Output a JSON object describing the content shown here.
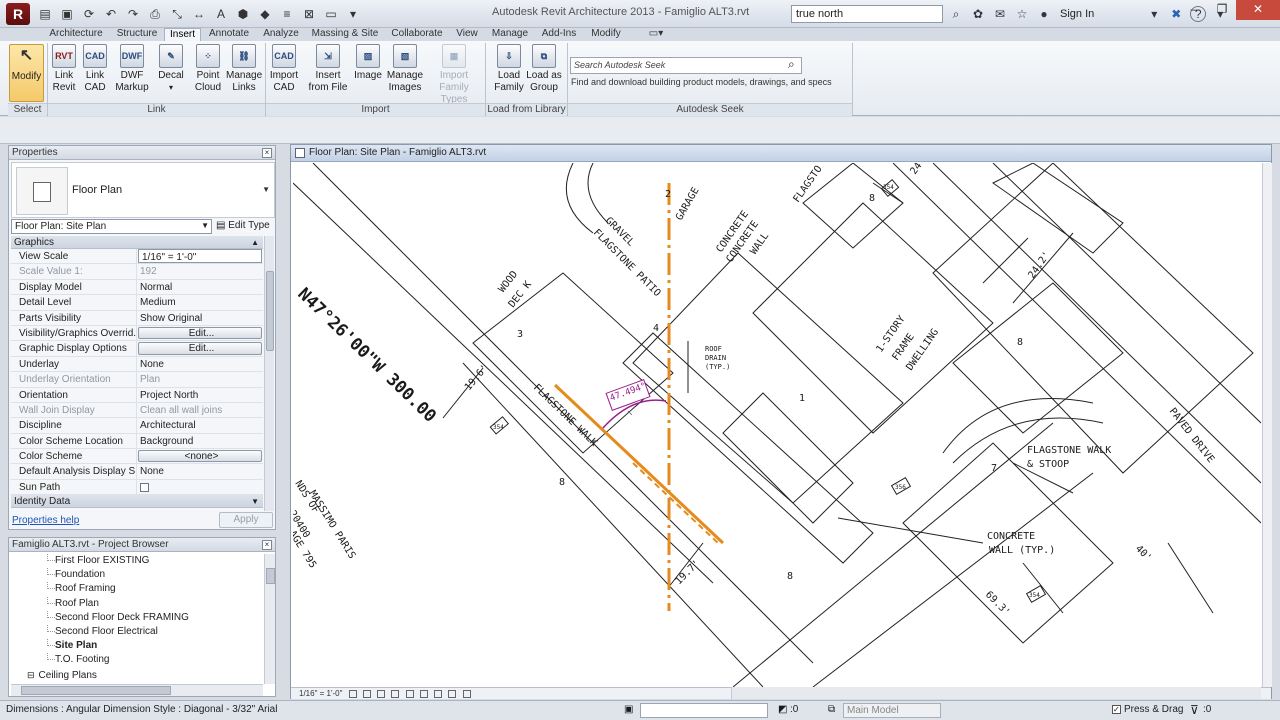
{
  "titlebar": {
    "app_button": "R",
    "title": "Autodesk Revit Architecture 2013 -    Famiglio ALT3.rvt",
    "search_value": "true north",
    "signin": "Sign In",
    "help": "?"
  },
  "ribbon_tabs": [
    "Architecture",
    "Structure",
    "Insert",
    "Annotate",
    "Analyze",
    "Massing & Site",
    "Collaborate",
    "View",
    "Manage",
    "Add-Ins",
    "Modify"
  ],
  "ribbon": {
    "buttons": {
      "modify": "Modify",
      "link_revit": "Link\nRevit",
      "link_cad": "Link\nCAD",
      "dwf_markup": "DWF\nMarkup",
      "decal": "Decal",
      "point_cloud": "Point\nCloud",
      "manage_links": "Manage\nLinks",
      "import_cad": "Import\nCAD",
      "insert_from_file": "Insert\nfrom File",
      "image": "Image",
      "manage_images": "Manage\nImages",
      "import_family_types": "Import\nFamily Types",
      "load_family": "Load\nFamily",
      "load_as_group": "Load as\nGroup"
    },
    "icon_text": {
      "rvt": "RVT",
      "cad": "CAD",
      "dwf": "DWF"
    },
    "panels": {
      "select": "Select",
      "link": "Link",
      "import": "Import",
      "load_from_library": "Load from Library",
      "autodesk_seek": "Autodesk Seek"
    },
    "seek_placeholder": "Search Autodesk Seek",
    "seek_description": "Find and download building product models, drawings, and specs"
  },
  "properties": {
    "title": "Properties",
    "type_name": "Floor Plan",
    "instance": "Floor Plan: Site Plan",
    "edit_type": "Edit Type",
    "group_graphics": "Graphics",
    "group_identity": "Identity Data",
    "rows": [
      {
        "name": "View Scale",
        "value": "1/16\" = 1'-0\""
      },
      {
        "name": "Scale Value    1:",
        "value": "192"
      },
      {
        "name": "Display Model",
        "value": "Normal"
      },
      {
        "name": "Detail Level",
        "value": "Medium"
      },
      {
        "name": "Parts Visibility",
        "value": "Show Original"
      },
      {
        "name": "Visibility/Graphics Overrid...",
        "value": "Edit..."
      },
      {
        "name": "Graphic Display Options",
        "value": "Edit..."
      },
      {
        "name": "Underlay",
        "value": "None"
      },
      {
        "name": "Underlay Orientation",
        "value": "Plan"
      },
      {
        "name": "Orientation",
        "value": "Project North"
      },
      {
        "name": "Wall Join Display",
        "value": "Clean all wall joins"
      },
      {
        "name": "Discipline",
        "value": "Architectural"
      },
      {
        "name": "Color Scheme Location",
        "value": "Background"
      },
      {
        "name": "Color Scheme",
        "value": "<none>"
      },
      {
        "name": "Default Analysis Display S...",
        "value": "None"
      },
      {
        "name": "Sun Path",
        "value": ""
      }
    ],
    "help_link": "Properties help",
    "apply": "Apply"
  },
  "browser": {
    "title": "Famiglio ALT3.rvt - Project Browser",
    "items": [
      {
        "label": "First Floor EXISTING"
      },
      {
        "label": "Foundation"
      },
      {
        "label": "Roof Framing"
      },
      {
        "label": "Roof Plan"
      },
      {
        "label": "Second Floor Deck FRAMING"
      },
      {
        "label": "Second Floor Electrical"
      },
      {
        "label": "Site Plan"
      },
      {
        "label": "T.O. Footing"
      },
      {
        "label": "Ceiling Plans"
      }
    ]
  },
  "view": {
    "title": "Floor Plan: Site Plan - Famiglio ALT3.rvt",
    "scale": "1/16\" = 1'-0\"",
    "dimension": "47.494°",
    "labels": {
      "bearing": "N47°26'00\"W 300.00",
      "gravel": "GRAVEL",
      "flagstone_patio": "FLAGSTONE PATIO",
      "garage": "GARAGE",
      "concrete_wall_1": "CONCRETE",
      "concrete_wall_2": "CONCRETE",
      "concrete_wall_3": "WALL",
      "wood": "WOOD",
      "deck": "DEC K",
      "roof": "ROOF",
      "drain": "DRAIN",
      "typ": "(TYP.)",
      "story_1": "1-STORY",
      "story_2": "FRAME",
      "story_3": "DWELLING",
      "flagstone_walk": "FLAGSTONE WALK",
      "flagstone_walk2": "FLAGSTONE WALK",
      "stoop": "& STOOP",
      "paved_drive": "PAVED DRIVE",
      "concrete_a": "CONCRETE",
      "concrete_b": "WALL (TYP.)",
      "lands_1": "NDS OF",
      "lands_2": "MASSIMO PARIS",
      "lands_3": "20400",
      "lands_4": "AGE 795",
      "flagsto": "FLAGSTO",
      "dim_196": "19.6'",
      "dim_197": "19.7'",
      "dim_242": "24.2'",
      "dim_693": "69.3'",
      "dim_40": "40'",
      "dim_24": "24",
      "n1": "1",
      "n3": "3",
      "n4": "4",
      "n7": "7",
      "n8a": "8",
      "n8b": "8",
      "n8c": "8",
      "n8d": "8",
      "n2": "2",
      "tag354a": "354",
      "tag354b": "354",
      "tag354c": "354",
      "tag356": "356"
    }
  },
  "status": {
    "text": "Dimensions : Angular Dimension Style : Diagonal - 3/32\" Arial",
    "zero": ":0",
    "model": "Main Model",
    "press_drag": "Press & Drag",
    "filter": ":0"
  }
}
